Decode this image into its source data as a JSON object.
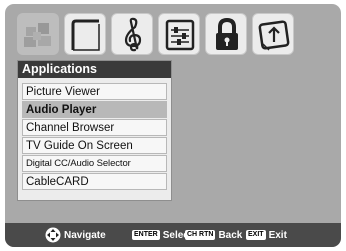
{
  "tabs": [
    {
      "name": "applications",
      "icon": "puzzle-icon",
      "active": true
    },
    {
      "name": "picture",
      "icon": "picture-icon",
      "active": false
    },
    {
      "name": "sound",
      "icon": "treble-clef-icon",
      "active": false
    },
    {
      "name": "setup",
      "icon": "settings-sliders-icon",
      "active": false
    },
    {
      "name": "locks",
      "icon": "lock-icon",
      "active": false
    },
    {
      "name": "installation",
      "icon": "install-icon",
      "active": false
    }
  ],
  "menu": {
    "title": "Applications",
    "items": [
      {
        "label": "Picture Viewer",
        "selected": false
      },
      {
        "label": "Audio Player",
        "selected": true
      },
      {
        "label": "Channel Browser",
        "selected": false
      },
      {
        "label": "TV Guide On Screen",
        "selected": false
      },
      {
        "label": "Digital CC/Audio Selector",
        "selected": false
      },
      {
        "label": "CableCARD",
        "selected": false
      }
    ]
  },
  "footer": {
    "navigate_label": "Navigate",
    "enter_key": "ENTER",
    "select_label": "Select",
    "chrtn_key": "CH RTN",
    "back_label": "Back",
    "exit_key": "EXIT",
    "exit_label": "Exit"
  },
  "colors": {
    "screen_bg": "#a9a9a9",
    "title_bar": "#3a3a3a",
    "selected_item": "#b8b8b8",
    "footer_bg": "#4a4a4a"
  }
}
